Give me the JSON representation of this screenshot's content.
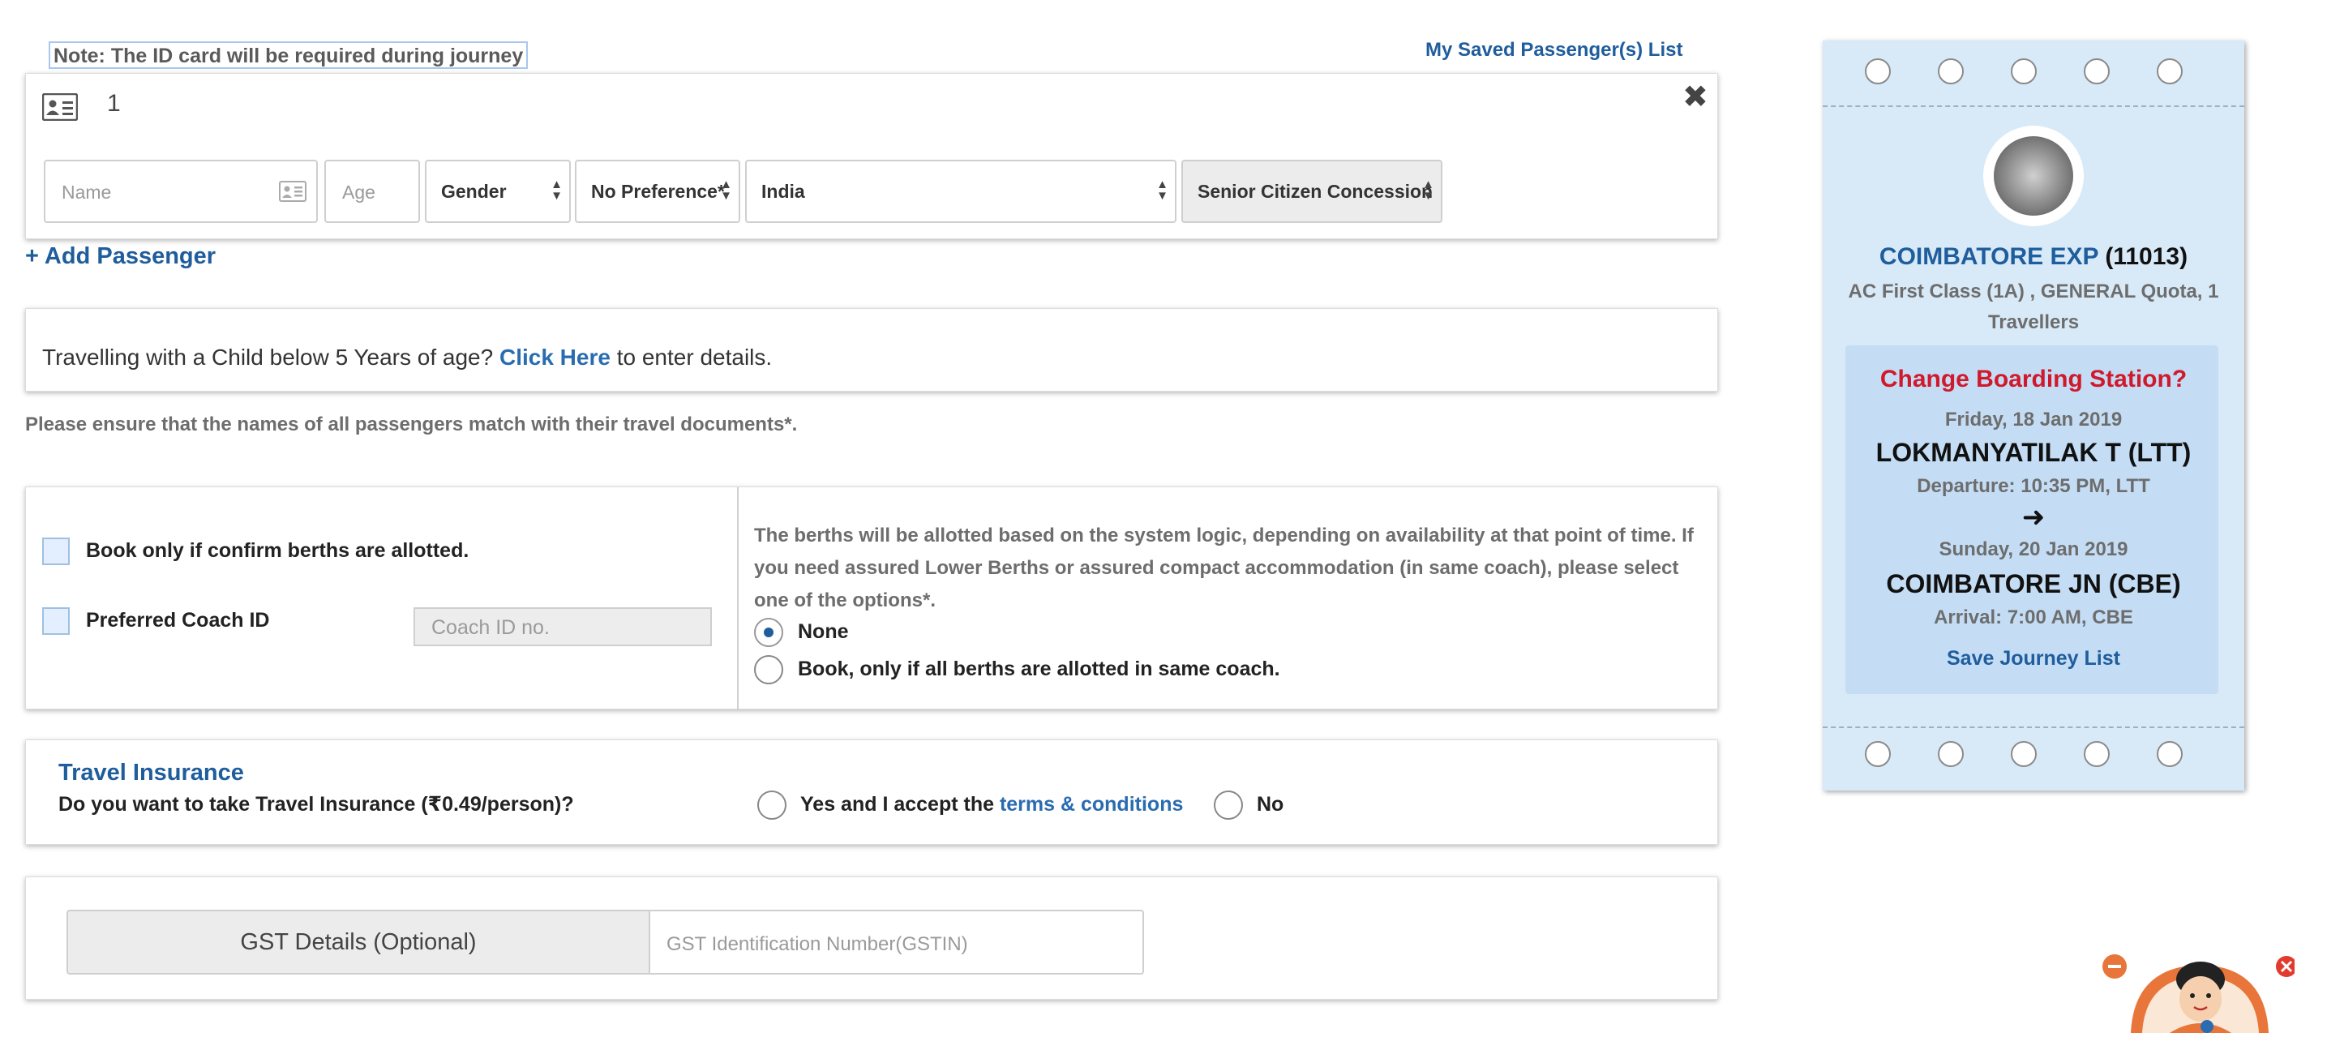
{
  "note": "Note: The ID card will be required during journey",
  "saved_list": "My Saved Passenger(s) List",
  "passenger": {
    "number": "1",
    "name_placeholder": "Name",
    "age_placeholder": "Age",
    "gender": "Gender",
    "berth_pref": "No Preference*",
    "nationality": "India",
    "concession": "Senior Citizen Concession"
  },
  "add_passenger": "+ Add Passenger",
  "child": {
    "prefix": "Travelling with a Child below 5 Years of age?",
    "link": "Click Here",
    "suffix": "to enter details."
  },
  "ensure_note": "Please ensure that the names of all passengers match with their travel documents*.",
  "berth": {
    "confirm_label": "Book only if confirm berths are allotted.",
    "coach_label": "Preferred Coach ID",
    "coach_placeholder": "Coach ID no.",
    "info": "The berths will be allotted based on the system logic, depending on availability at that point of time. If you need assured Lower Berths or assured compact accommodation (in same coach), please select one of the options*.",
    "opt_none": "None",
    "opt_same_coach": "Book, only if all berths are allotted in same coach.",
    "selected": "None"
  },
  "insurance": {
    "title": "Travel Insurance",
    "question": "Do you want to take Travel Insurance (₹0.49/person)?",
    "yes_prefix": "Yes and I accept the",
    "terms_link": "terms & conditions",
    "no": "No"
  },
  "gst": {
    "button": "GST Details (Optional)",
    "placeholder": "GST Identification Number(GSTIN)"
  },
  "ticket": {
    "train_name": "COIMBATORE EXP",
    "train_no": "(11013)",
    "class_info": "AC First Class (1A) , GENERAL Quota, 1",
    "travellers": "Travellers",
    "change_boarding": "Change Boarding Station?",
    "from_date": "Friday, 18 Jan 2019",
    "from_station": "LOKMANYATILAK T (LTT)",
    "departure": "Departure: 10:35 PM, LTT",
    "to_date": "Sunday, 20 Jan 2019",
    "to_station": "COIMBATORE JN (CBE)",
    "arrival": "Arrival: 7:00 AM, CBE",
    "save_journey": "Save Journey List"
  },
  "colors": {
    "brand_blue": "#1f5d9c",
    "alert_red": "#d0192b",
    "ticket_bg": "#d8eaf8"
  }
}
